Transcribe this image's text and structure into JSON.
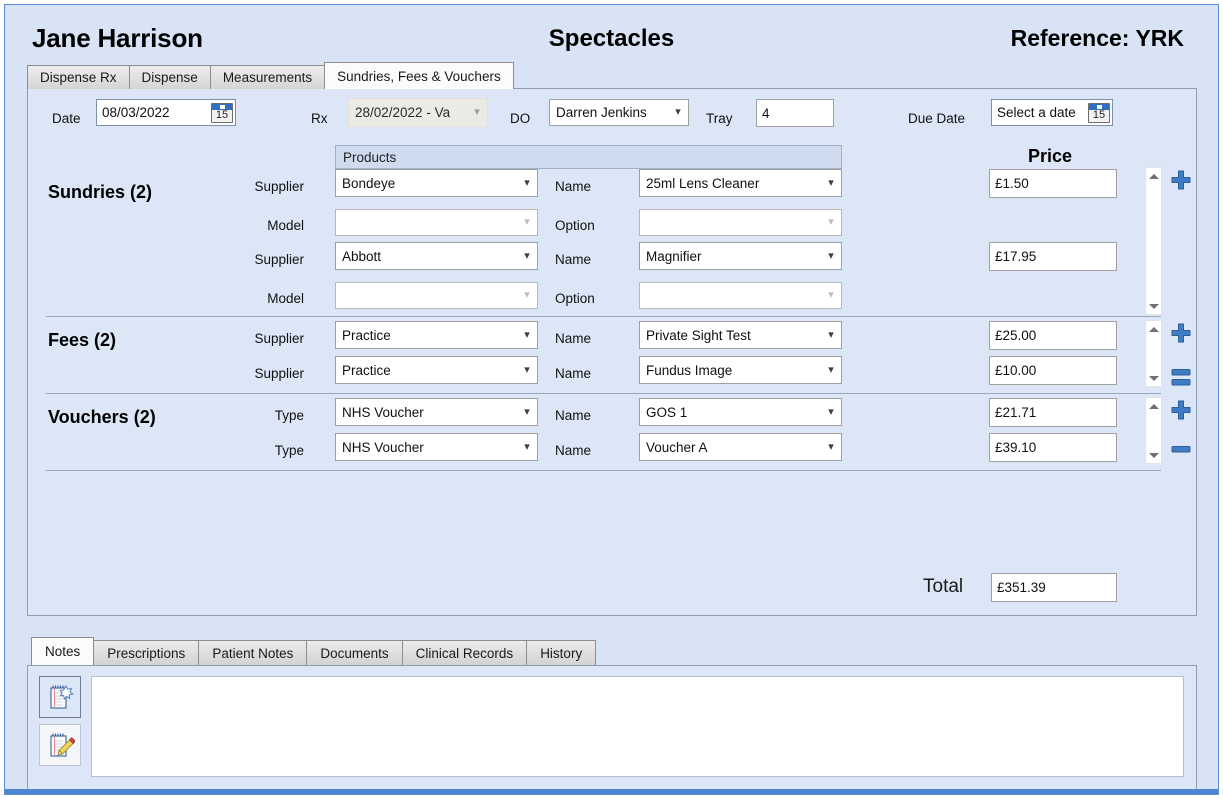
{
  "header": {
    "patient_name": "Jane Harrison",
    "title": "Spectacles",
    "reference": "Reference: YRK"
  },
  "top_tabs": [
    {
      "label": "Dispense Rx",
      "active": false
    },
    {
      "label": "Dispense",
      "active": false
    },
    {
      "label": "Measurements",
      "active": false
    },
    {
      "label": "Sundries, Fees & Vouchers",
      "active": true
    }
  ],
  "form": {
    "date_label": "Date",
    "date_value": "08/03/2022",
    "date_icon_day": "15",
    "rx_label": "Rx",
    "rx_value": "28/02/2022 - Va",
    "do_label": "DO",
    "do_value": "Darren Jenkins",
    "tray_label": "Tray",
    "tray_value": "4",
    "due_date_label": "Due Date",
    "due_date_value": "Select a date",
    "due_date_icon_day": "15"
  },
  "columns": {
    "products_header": "Products",
    "price_header": "Price"
  },
  "sections": [
    {
      "title": "Sundries (2)",
      "rows": [
        {
          "left_label": "Supplier",
          "left_value": "Bondeye",
          "right_label": "Name",
          "right_value": "25ml Lens Cleaner",
          "price": "£1.50",
          "dim": false
        },
        {
          "left_label": "Model",
          "left_value": "",
          "right_label": "Option",
          "right_value": "",
          "price": "",
          "dim": true
        },
        {
          "left_label": "Supplier",
          "left_value": "Abbott",
          "right_label": "Name",
          "right_value": "Magnifier",
          "price": "£17.95",
          "dim": false
        },
        {
          "left_label": "Model",
          "left_value": "",
          "right_label": "Option",
          "right_value": "",
          "price": "",
          "dim": true
        }
      ]
    },
    {
      "title": "Fees (2)",
      "rows": [
        {
          "left_label": "Supplier",
          "left_value": "Practice",
          "right_label": "Name",
          "right_value": "Private Sight Test",
          "price": "£25.00",
          "dim": false
        },
        {
          "left_label": "Supplier",
          "left_value": "Practice",
          "right_label": "Name",
          "right_value": "Fundus Image",
          "price": "£10.00",
          "dim": false
        }
      ]
    },
    {
      "title": "Vouchers (2)",
      "rows": [
        {
          "left_label": "Type",
          "left_value": "NHS Voucher",
          "right_label": "Name",
          "right_value": "GOS 1",
          "price": "£21.71",
          "dim": false
        },
        {
          "left_label": "Type",
          "left_value": "NHS Voucher",
          "right_label": "Name",
          "right_value": "Voucher A",
          "price": "£39.10",
          "dim": false
        }
      ]
    }
  ],
  "total": {
    "label": "Total",
    "value": "£351.39"
  },
  "bottom_tabs": [
    {
      "label": "Notes",
      "active": true
    },
    {
      "label": "Prescriptions",
      "active": false
    },
    {
      "label": "Patient Notes",
      "active": false
    },
    {
      "label": "Documents",
      "active": false
    },
    {
      "label": "Clinical Records",
      "active": false
    },
    {
      "label": "History",
      "active": false
    }
  ],
  "notes": {
    "text": "",
    "icons": [
      {
        "name": "new-note-icon",
        "selected": true
      },
      {
        "name": "edit-note-icon",
        "selected": false
      }
    ]
  },
  "colors": {
    "background": "#d8e3f6",
    "panel": "#dce6f7",
    "accent": "#2f6fbf",
    "plus_minus": "#3f7cc4",
    "border": "#8d9bb3",
    "bottom_bar": "#4e85d0"
  }
}
